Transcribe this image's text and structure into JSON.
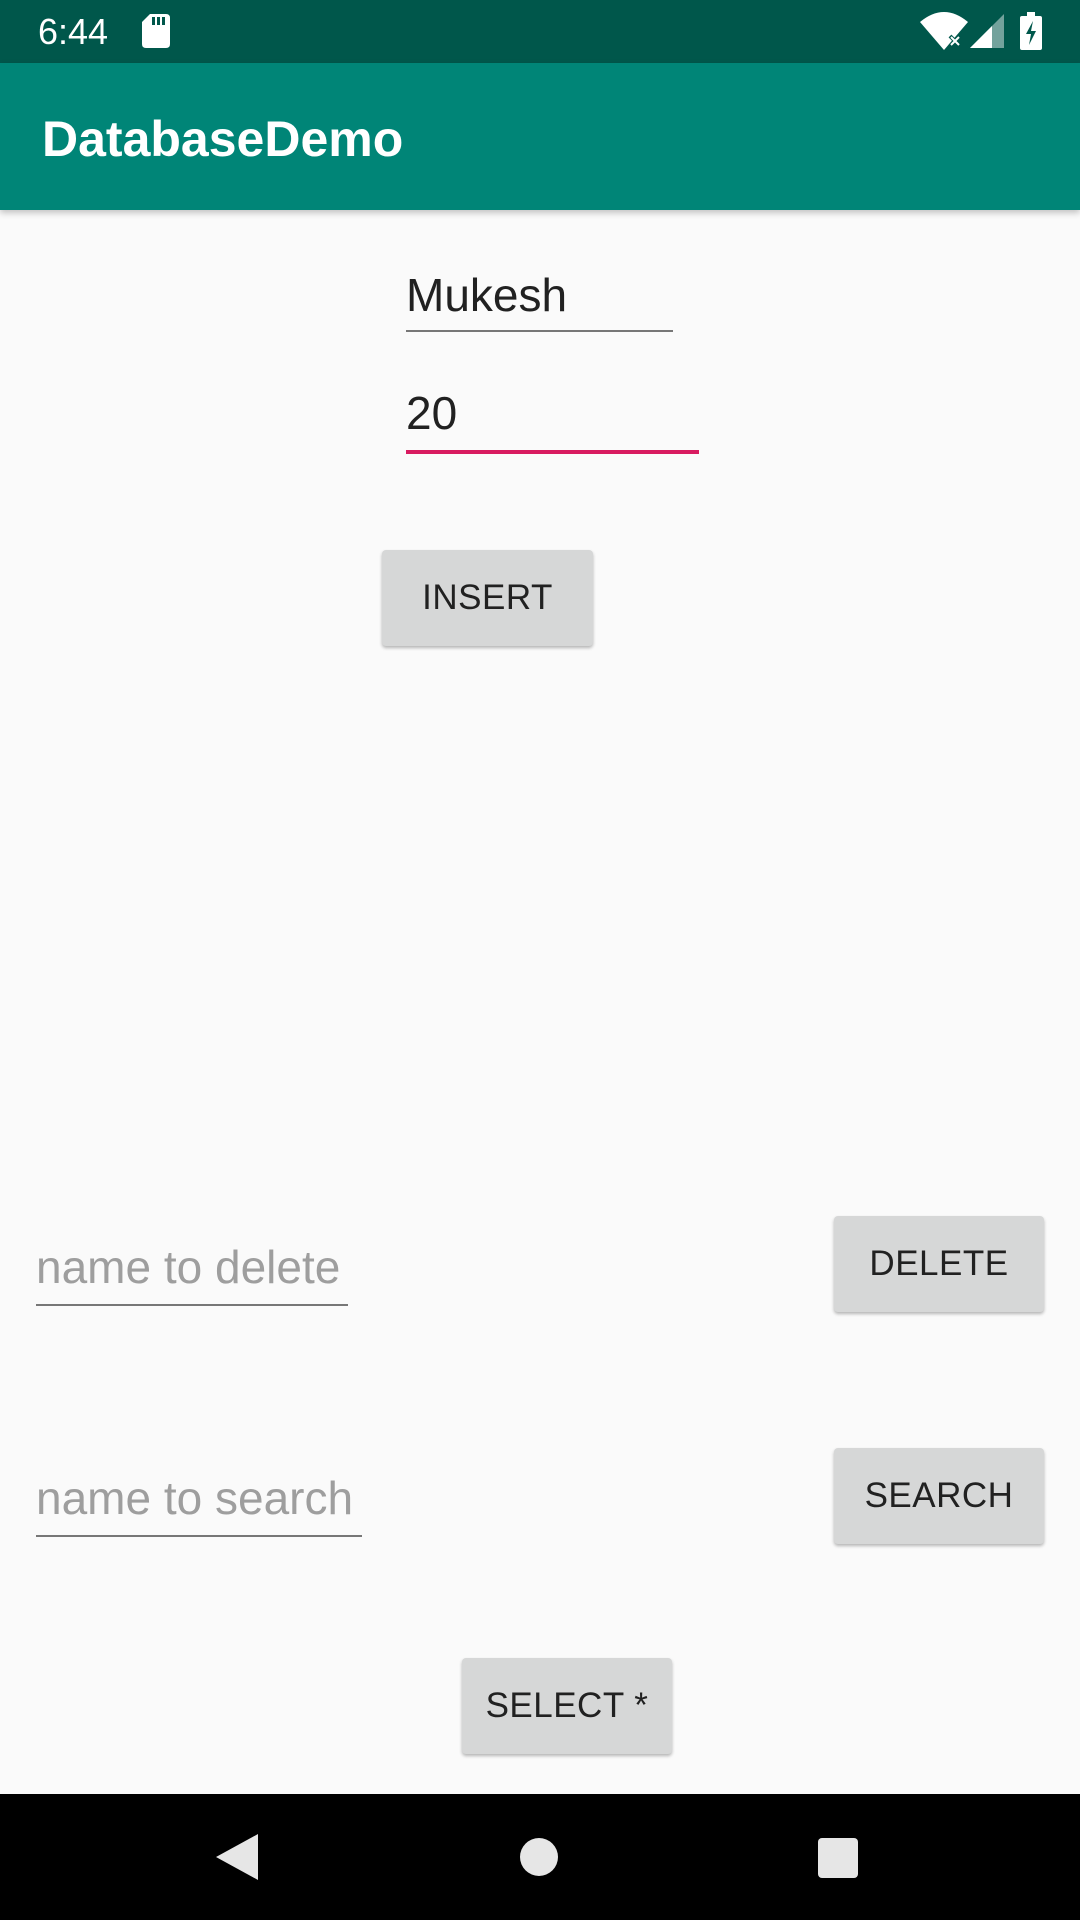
{
  "status_bar": {
    "time": "6:44",
    "icons": [
      "sd-card-icon",
      "wifi-icon",
      "signal-icon",
      "battery-icon"
    ]
  },
  "app_bar": {
    "title": "DatabaseDemo",
    "color": "#008577",
    "status_color": "#00574b"
  },
  "form": {
    "name_value": "Mukesh",
    "age_value": "20",
    "insert_label": "INSERT",
    "accent_color": "#d81b60"
  },
  "delete": {
    "placeholder": "name to delete",
    "button_label": "DELETE"
  },
  "search": {
    "placeholder": "name to search",
    "button_label": "SEARCH"
  },
  "select": {
    "button_label": "SELECT *"
  },
  "nav_bar": {
    "icons": [
      "back-icon",
      "home-icon",
      "recents-icon"
    ]
  }
}
